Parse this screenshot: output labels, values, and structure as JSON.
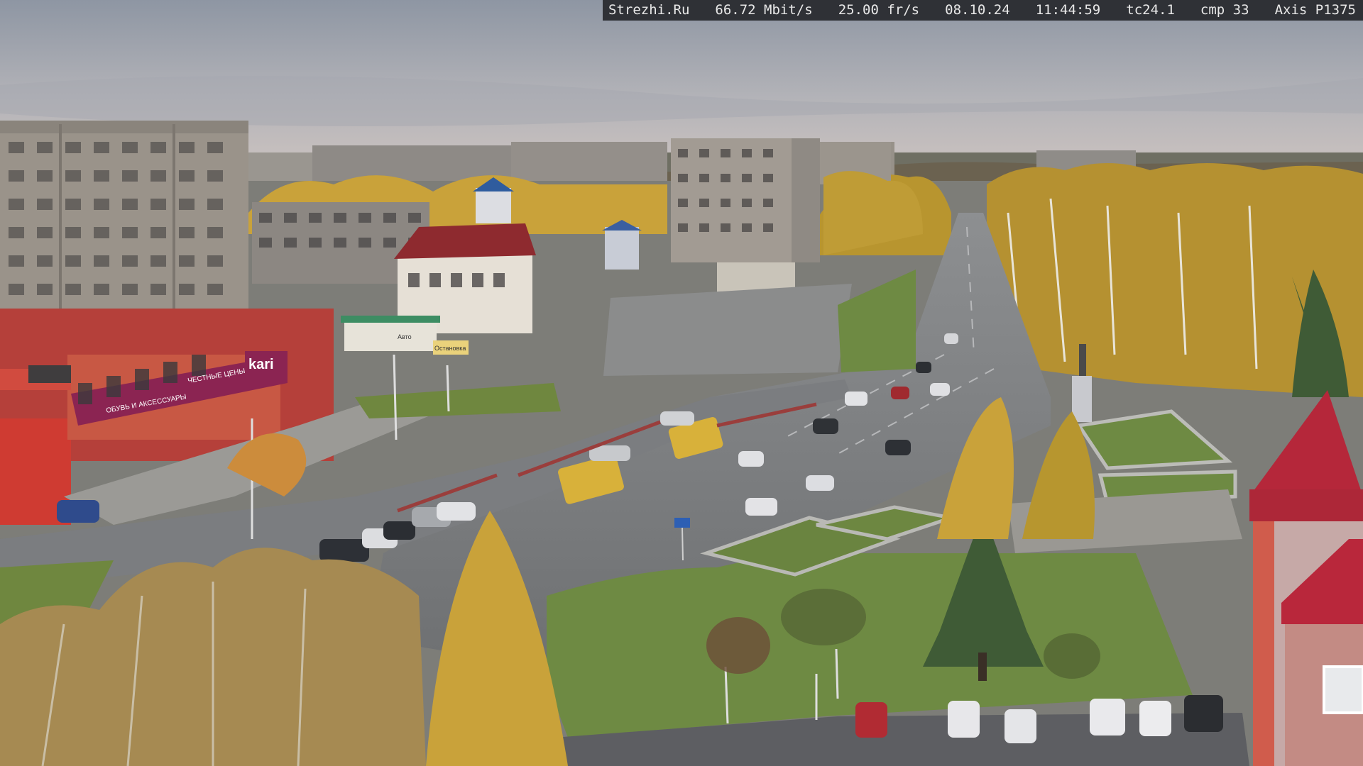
{
  "overlay": {
    "site": "Strezhi.Ru",
    "bitrate": "66.72 Mbit/s",
    "framerate": "25.00 fr/s",
    "date": "08.10.24",
    "time": "11:44:59",
    "tc": "tc24.1",
    "cmp": "cmp 33",
    "camera": "Axis P1375"
  },
  "signs": {
    "store_brand": "kari",
    "store_tagline": "ОБУВЬ И АКСЕССУАРЫ",
    "store_sub": "ЧЕСТНЫЕ ЦЕНЫ",
    "bus_stop": "Остановка",
    "kiosk": "Авто"
  },
  "colors": {
    "sky_top": "#8e96a3",
    "sky_horizon": "#c9c1bf",
    "road": "#7a7c7e",
    "grass": "#6e8a43",
    "autumn_yellow": "#c9a23a",
    "brick_red": "#b5403a",
    "bus_yellow": "#d8b13a"
  }
}
